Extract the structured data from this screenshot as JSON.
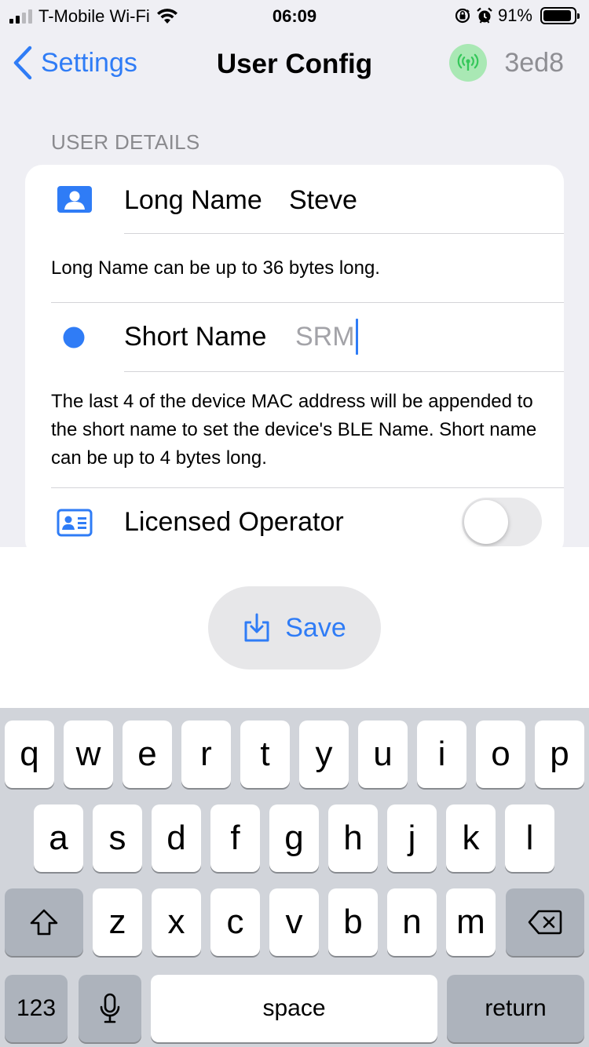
{
  "status_bar": {
    "carrier": "T-Mobile Wi-Fi",
    "time": "06:09",
    "battery": "91%",
    "battery_level": 0.91,
    "icons": [
      "signal-icon",
      "wifi-icon",
      "orientation-lock-icon",
      "alarm-icon",
      "battery-icon"
    ]
  },
  "nav": {
    "back_label": "Settings",
    "title": "User Config",
    "node_id": "3ed8",
    "node_icon": "antenna-icon",
    "node_icon_color": "#34c759"
  },
  "section": {
    "header": "USER DETAILS"
  },
  "long_name": {
    "label": "Long Name",
    "value": "Steve",
    "icon": "person-card-icon",
    "note": "Long Name can be up to 36 bytes long."
  },
  "short_name": {
    "label": "Short Name",
    "placeholder": "SRM",
    "icon": "circle-icon",
    "note": "The last 4 of the device MAC address will be appended to the short name to set the device's BLE Name.  Short name can be up to 4 bytes long."
  },
  "licensed_operator": {
    "label": "Licensed Operator",
    "icon": "id-card-icon",
    "enabled": false
  },
  "save_button": {
    "label": "Save",
    "icon": "save-tray-icon"
  },
  "keyboard": {
    "row1": [
      "q",
      "w",
      "e",
      "r",
      "t",
      "y",
      "u",
      "i",
      "o",
      "p"
    ],
    "row2": [
      "a",
      "s",
      "d",
      "f",
      "g",
      "h",
      "j",
      "k",
      "l"
    ],
    "row3": [
      "z",
      "x",
      "c",
      "v",
      "b",
      "n",
      "m"
    ],
    "numbers_label": "123",
    "space_label": "space",
    "return_label": "return"
  },
  "colors": {
    "accent": "#2f7cf6",
    "background": "#efeff4",
    "toggle_off": "#e9e9eb"
  }
}
